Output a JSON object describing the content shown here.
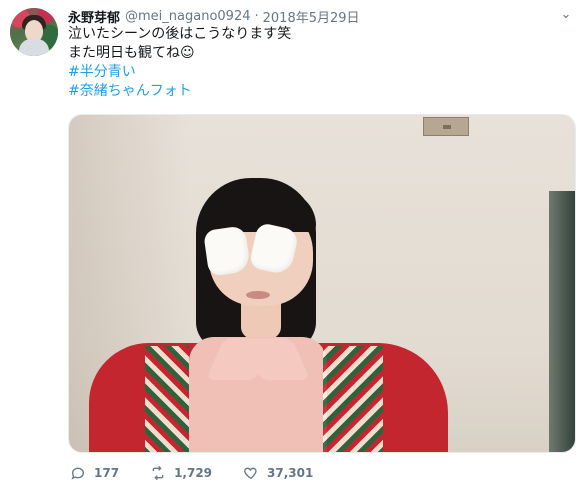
{
  "tweet": {
    "author": {
      "name": "永野芽郁",
      "handle": "@mei_nagano0924",
      "date": "2018年5月29日"
    },
    "text": {
      "line1": "泣いたシーンの後はこうなります笑",
      "line2": "また明日も観てね☺",
      "hashtags": [
        "#半分青い",
        "#奈緒ちゃんフォト"
      ]
    },
    "actions": {
      "reply_count": "177",
      "retweet_count": "1,729",
      "like_count": "37,301"
    },
    "icons": {
      "caret": "chevron-down-icon",
      "reply": "reply-icon",
      "retweet": "retweet-icon",
      "like": "heart-icon"
    }
  }
}
